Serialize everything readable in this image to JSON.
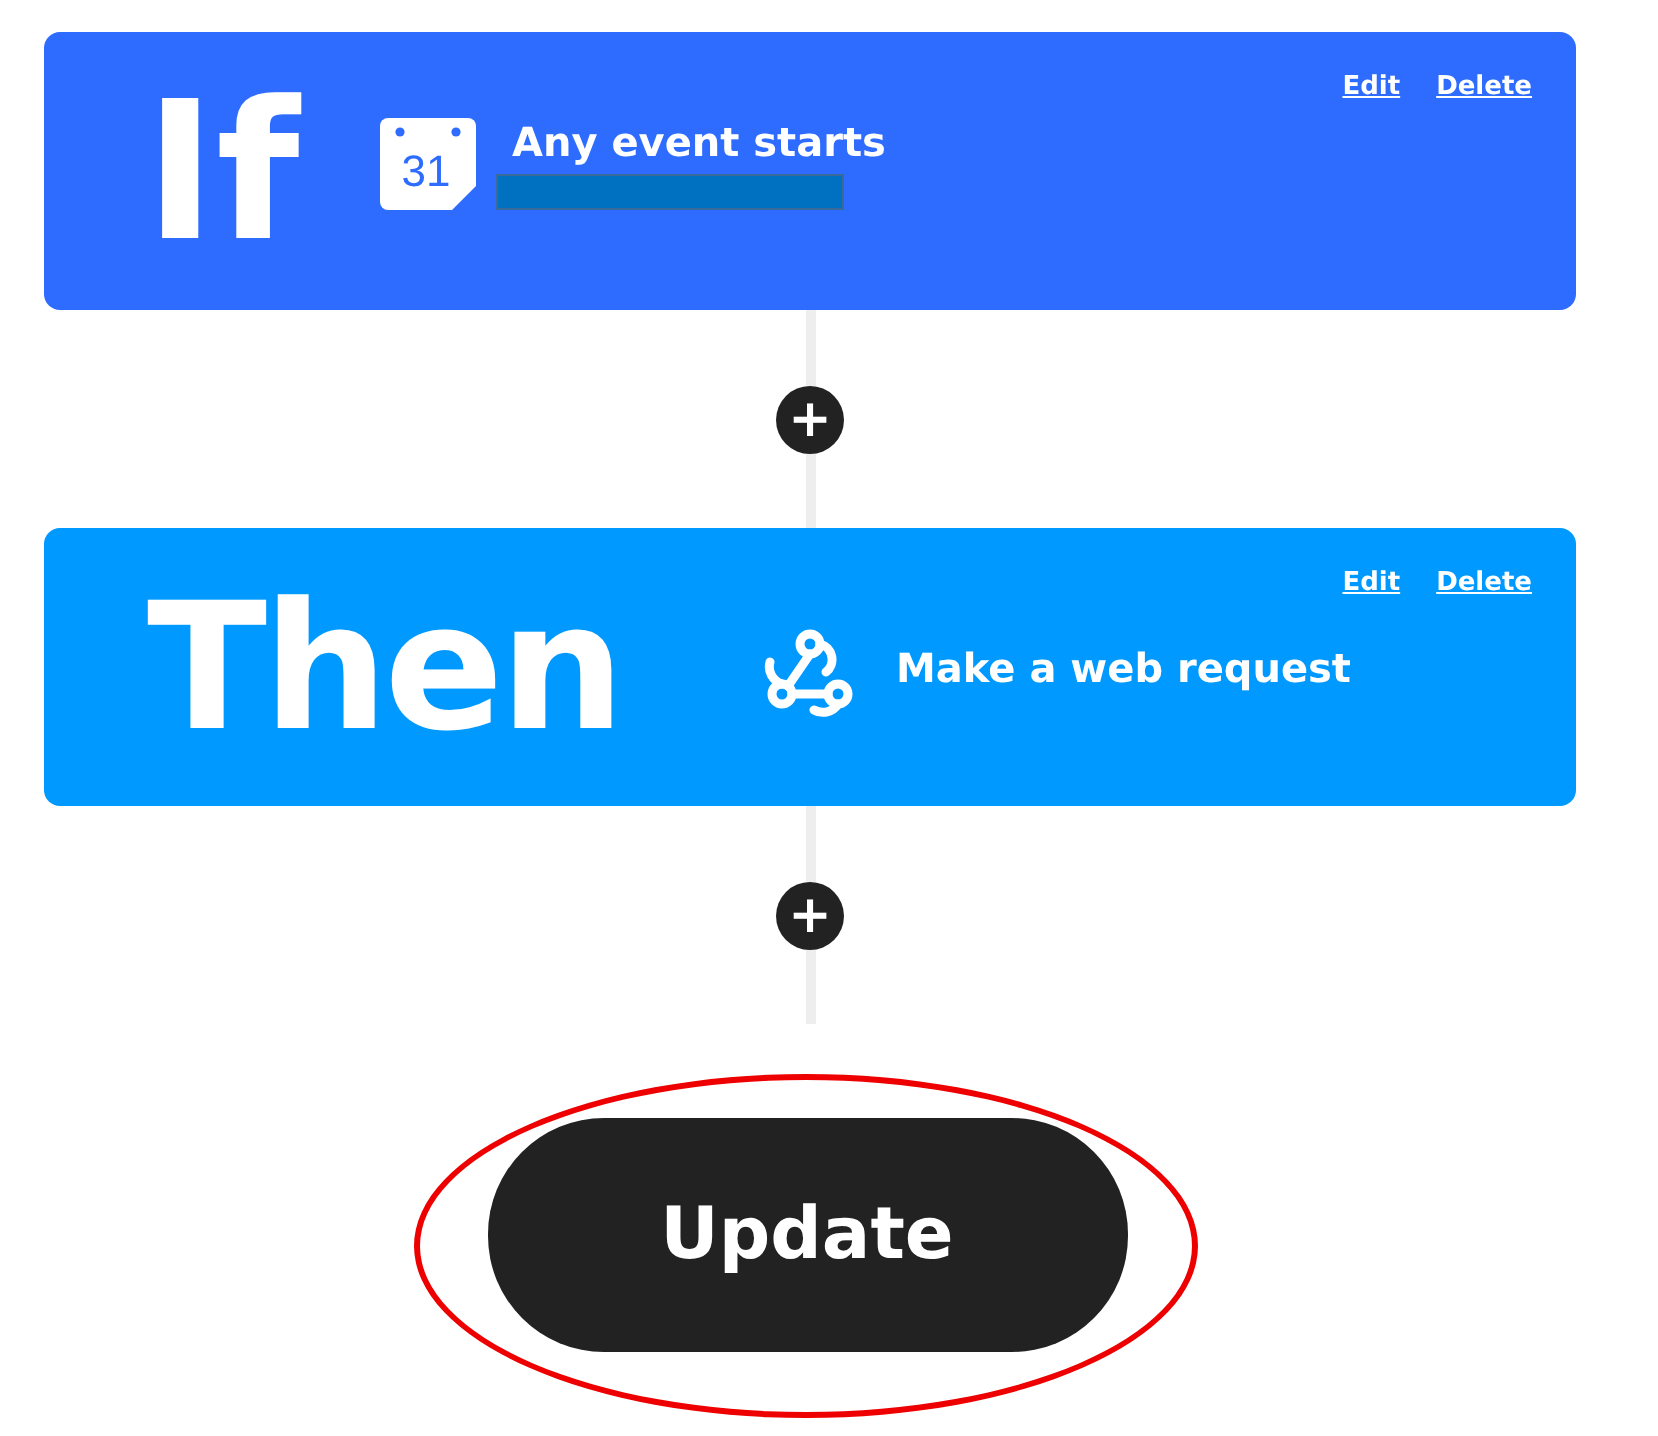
{
  "steps": [
    {
      "kind": "trigger",
      "keyword": "If",
      "icon_text": "31",
      "title": "Any event starts",
      "redacted": true,
      "links": [
        "Edit",
        "Delete"
      ]
    },
    {
      "kind": "action",
      "keyword": "Then",
      "title": "Make a web request",
      "redacted": false,
      "links": [
        "Edit",
        "Delete"
      ]
    }
  ],
  "add_buttons": [
    "+",
    "+"
  ],
  "update_button": {
    "label": "Update",
    "highlighted": true
  }
}
